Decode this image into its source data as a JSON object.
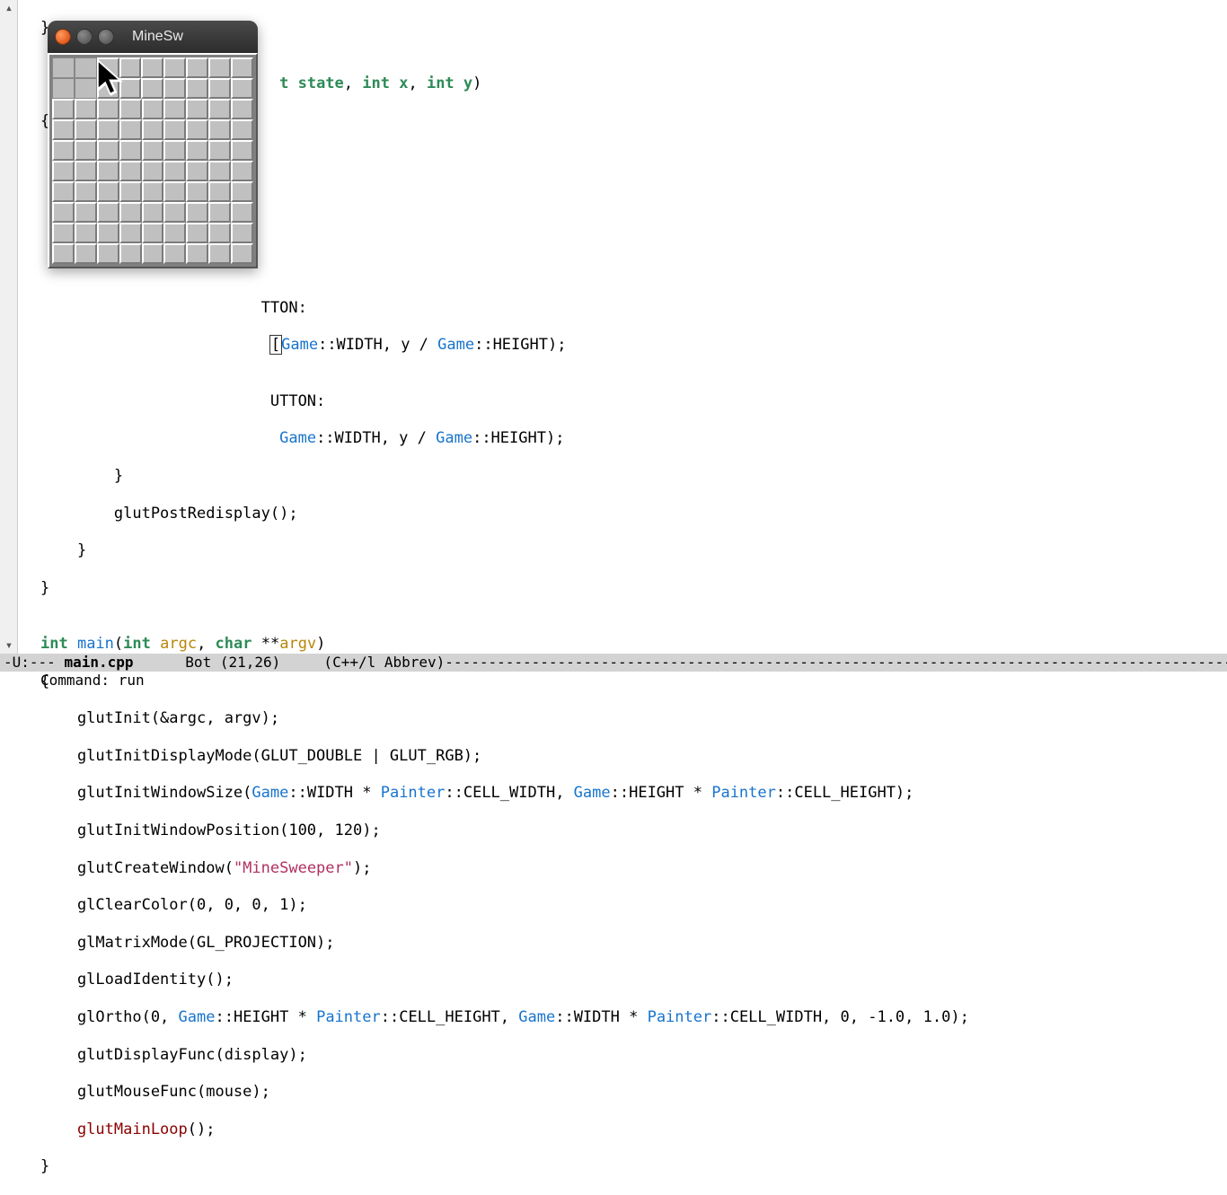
{
  "code": {
    "l0": "}",
    "l1": "",
    "fn_sig_pre": "                          ",
    "fn_sig_state_kw": "t",
    "fn_sig_state": " state",
    "fn_sig_comma1": ", ",
    "fn_sig_int_x": "int",
    "fn_sig_x": " x",
    "fn_sig_comma2": ", ",
    "fn_sig_int_y": "int",
    "fn_sig_y": " y",
    "fn_sig_close": ")",
    "l3": "{",
    "l8": "                        TTON:",
    "l9_pre": "                         ",
    "l9_game1": "Game",
    "l9_mid1": "::WIDTH, y / ",
    "l9_game2": "Game",
    "l9_end": "::HEIGHT);",
    "l10": "",
    "l11": "                         UTTON:",
    "l12_pre": "                          ",
    "l12_game1": "Game",
    "l12_mid1": "::WIDTH, y / ",
    "l12_game2": "Game",
    "l12_end": "::HEIGHT);",
    "l13": "        }",
    "l14": "        glutPostRedisplay();",
    "l15": "    }",
    "l16": "}",
    "l17": "",
    "l18_int": "int",
    "l18_main": " main",
    "l18_open": "(",
    "l18_intarg": "int",
    "l18_argc": " argc",
    "l18_comma": ", ",
    "l18_char": "char",
    "l18_stars": " **",
    "l18_argv": "argv",
    "l18_close": ")",
    "l19": "{",
    "l20": "    glutInit(&argc, argv);",
    "l21": "    glutInitDisplayMode(GLUT_DOUBLE | GLUT_RGB);",
    "l22_pre": "    glutInitWindowSize(",
    "l22_game1": "Game",
    "l22_mid1": "::WIDTH * ",
    "l22_paint1": "Painter",
    "l22_mid2": "::CELL_WIDTH, ",
    "l22_game2": "Game",
    "l22_mid3": "::HEIGHT * ",
    "l22_paint2": "Painter",
    "l22_end": "::CELL_HEIGHT);",
    "l23": "    glutInitWindowPosition(100, 120);",
    "l24_pre": "    glutCreateWindow(",
    "l24_str": "\"MineSweeper\"",
    "l24_end": ");",
    "l25": "    glClearColor(0, 0, 0, 1);",
    "l26": "    glMatrixMode(GL_PROJECTION);",
    "l27": "    glLoadIdentity();",
    "l28_pre": "    glOrtho(0, ",
    "l28_game1": "Game",
    "l28_mid1": "::HEIGHT * ",
    "l28_paint1": "Painter",
    "l28_mid2": "::CELL_HEIGHT, ",
    "l28_game2": "Game",
    "l28_mid3": "::WIDTH * ",
    "l28_paint2": "Painter",
    "l28_end": "::CELL_WIDTH, 0, -1.0, 1.0);",
    "l29": "    glutDisplayFunc(display);",
    "l30": "    glutMouseFunc(mouse);",
    "l31_fn": "    glutMainLoop",
    "l31_end": "();",
    "l32": "}"
  },
  "modeline": {
    "left": "-U:--- ",
    "buffer": "main.cpp",
    "pos": "      Bot (21,26)",
    "mode": "     (C++/l Abbrev)"
  },
  "minibuffer": {
    "text": "Command: run"
  },
  "minesweeper": {
    "title": "MineSw",
    "rows": 10,
    "cols": 9,
    "pressed_cells": [
      [
        0,
        0
      ],
      [
        0,
        1
      ],
      [
        1,
        0
      ],
      [
        1,
        1
      ]
    ]
  }
}
